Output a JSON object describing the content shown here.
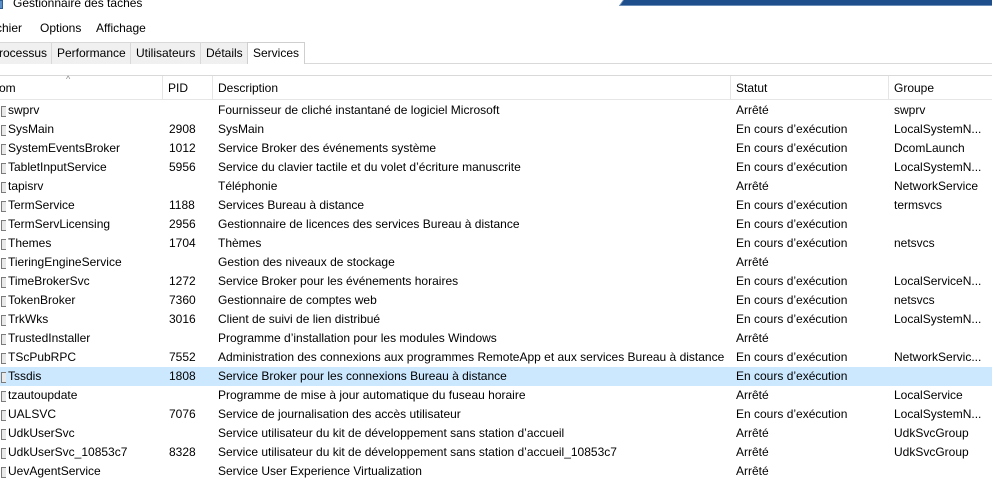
{
  "window": {
    "title": "Gestionnaire des tâches"
  },
  "menu": [
    "chier",
    "Options",
    "Affichage"
  ],
  "tabs": [
    {
      "label": "rocessus",
      "active": false
    },
    {
      "label": "Performance",
      "active": false
    },
    {
      "label": "Utilisateurs",
      "active": false
    },
    {
      "label": "Détails",
      "active": false
    },
    {
      "label": "Services",
      "active": true
    }
  ],
  "columns": {
    "name": "om",
    "pid": "PID",
    "description": "Description",
    "status": "Statut",
    "group": "Groupe"
  },
  "selected_row": "Tssdis",
  "colors": {
    "selection": "#cce8ff",
    "window_accent": "#1f4e8c"
  },
  "services": [
    {
      "name": "swprv",
      "pid": "",
      "description": "Fournisseur de cliché instantané de logiciel Microsoft",
      "status": "Arrêté",
      "group": "swprv"
    },
    {
      "name": "SysMain",
      "pid": "2908",
      "description": "SysMain",
      "status": "En cours d’exécution",
      "group": "LocalSystemN..."
    },
    {
      "name": "SystemEventsBroker",
      "pid": "1012",
      "description": "Service Broker des événements système",
      "status": "En cours d’exécution",
      "group": "DcomLaunch"
    },
    {
      "name": "TabletInputService",
      "pid": "5956",
      "description": "Service du clavier tactile et du volet d’écriture manuscrite",
      "status": "En cours d’exécution",
      "group": "LocalSystemN..."
    },
    {
      "name": "tapisrv",
      "pid": "",
      "description": "Téléphonie",
      "status": "Arrêté",
      "group": "NetworkService"
    },
    {
      "name": "TermService",
      "pid": "1188",
      "description": "Services Bureau à distance",
      "status": "En cours d’exécution",
      "group": "termsvcs"
    },
    {
      "name": "TermServLicensing",
      "pid": "2956",
      "description": "Gestionnaire de licences des services Bureau à distance",
      "status": "En cours d’exécution",
      "group": ""
    },
    {
      "name": "Themes",
      "pid": "1704",
      "description": "Thèmes",
      "status": "En cours d’exécution",
      "group": "netsvcs"
    },
    {
      "name": "TieringEngineService",
      "pid": "",
      "description": "Gestion des niveaux de stockage",
      "status": "Arrêté",
      "group": ""
    },
    {
      "name": "TimeBrokerSvc",
      "pid": "1272",
      "description": "Service Broker pour les événements horaires",
      "status": "En cours d’exécution",
      "group": "LocalServiceN..."
    },
    {
      "name": "TokenBroker",
      "pid": "7360",
      "description": "Gestionnaire de comptes web",
      "status": "En cours d’exécution",
      "group": "netsvcs"
    },
    {
      "name": "TrkWks",
      "pid": "3016",
      "description": "Client de suivi de lien distribué",
      "status": "En cours d’exécution",
      "group": "LocalSystemN..."
    },
    {
      "name": "TrustedInstaller",
      "pid": "",
      "description": "Programme d’installation pour les modules Windows",
      "status": "Arrêté",
      "group": ""
    },
    {
      "name": "TScPubRPC",
      "pid": "7552",
      "description": "Administration des connexions aux programmes RemoteApp et aux services Bureau à distance",
      "status": "En cours d’exécution",
      "group": "NetworkServic..."
    },
    {
      "name": "Tssdis",
      "pid": "1808",
      "description": "Service Broker pour les connexions Bureau à distance",
      "status": "En cours d’exécution",
      "group": ""
    },
    {
      "name": "tzautoupdate",
      "pid": "",
      "description": "Programme de mise à jour automatique du fuseau horaire",
      "status": "Arrêté",
      "group": "LocalService"
    },
    {
      "name": "UALSVC",
      "pid": "7076",
      "description": "Service de journalisation des accès utilisateur",
      "status": "En cours d’exécution",
      "group": "LocalSystemN..."
    },
    {
      "name": "UdkUserSvc",
      "pid": "",
      "description": "Service utilisateur du kit de développement sans station d’accueil",
      "status": "Arrêté",
      "group": "UdkSvcGroup"
    },
    {
      "name": "UdkUserSvc_10853c7",
      "pid": "8328",
      "description": "Service utilisateur du kit de développement sans station d’accueil_10853c7",
      "status": "Arrêté",
      "group": "UdkSvcGroup"
    },
    {
      "name": "UevAgentService",
      "pid": "",
      "description": "Service User Experience Virtualization",
      "status": "Arrêté",
      "group": ""
    }
  ]
}
